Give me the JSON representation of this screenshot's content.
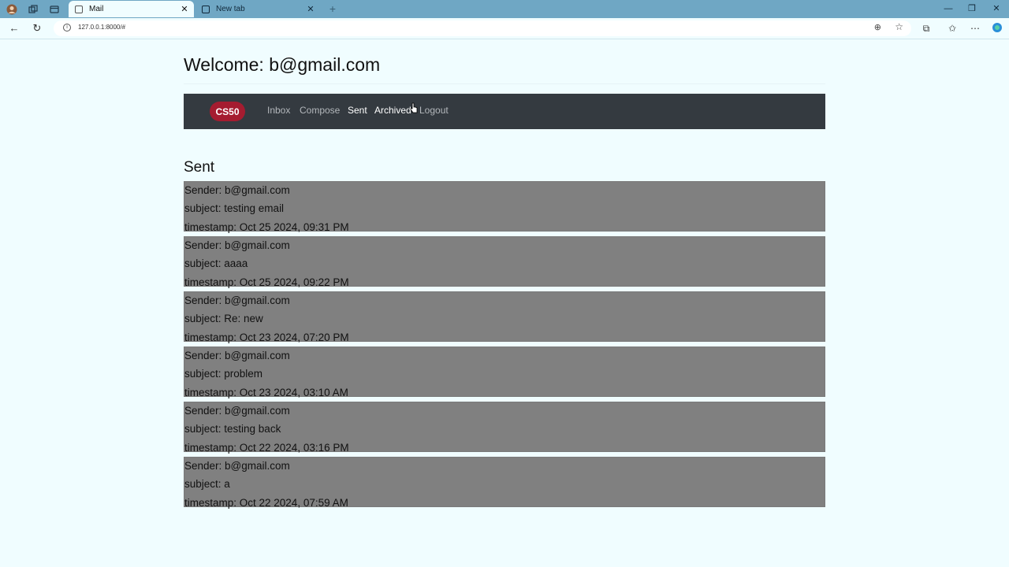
{
  "browser": {
    "tabs": [
      {
        "title": "Mail",
        "active": true
      },
      {
        "title": "New tab",
        "active": false
      }
    ],
    "address": {
      "url": "127.0.0.1:8000/#"
    },
    "icons": {
      "tab_actions": "tab-actions-icon",
      "collections": "collections-icon",
      "tab_list": "tab-list-icon"
    }
  },
  "page": {
    "welcome": "Welcome: b@gmail.com",
    "brand": "CS50",
    "nav": [
      {
        "label": "Inbox",
        "active": false
      },
      {
        "label": "Compose",
        "active": false
      },
      {
        "label": "Sent",
        "active": true
      },
      {
        "label": "Archived",
        "active": false
      },
      {
        "label": "Logout",
        "active": false
      }
    ],
    "section_title": "Sent",
    "emails": [
      {
        "sender": "Sender: b@gmail.com",
        "subject": "subject: testing email",
        "timestamp": "timestamp: Oct 25 2024, 09:31 PM"
      },
      {
        "sender": "Sender: b@gmail.com",
        "subject": "subject: aaaa",
        "timestamp": "timestamp: Oct 25 2024, 09:22 PM"
      },
      {
        "sender": "Sender: b@gmail.com",
        "subject": "subject: Re: new",
        "timestamp": "timestamp: Oct 23 2024, 07:20 PM"
      },
      {
        "sender": "Sender: b@gmail.com",
        "subject": "subject: problem",
        "timestamp": "timestamp: Oct 23 2024, 03:10 AM"
      },
      {
        "sender": "Sender: b@gmail.com",
        "subject": "subject: testing back",
        "timestamp": "timestamp: Oct 22 2024, 03:16 PM"
      },
      {
        "sender": "Sender: b@gmail.com",
        "subject": "subject: a",
        "timestamp": "timestamp: Oct 22 2024, 07:59 AM"
      }
    ]
  },
  "colors": {
    "page_bg": "#f0fdff",
    "navbar_bg": "#343a40",
    "brand_bg": "#a51c30",
    "email_bg": "#808080",
    "tabbar_bg": "#6fa7c4"
  }
}
